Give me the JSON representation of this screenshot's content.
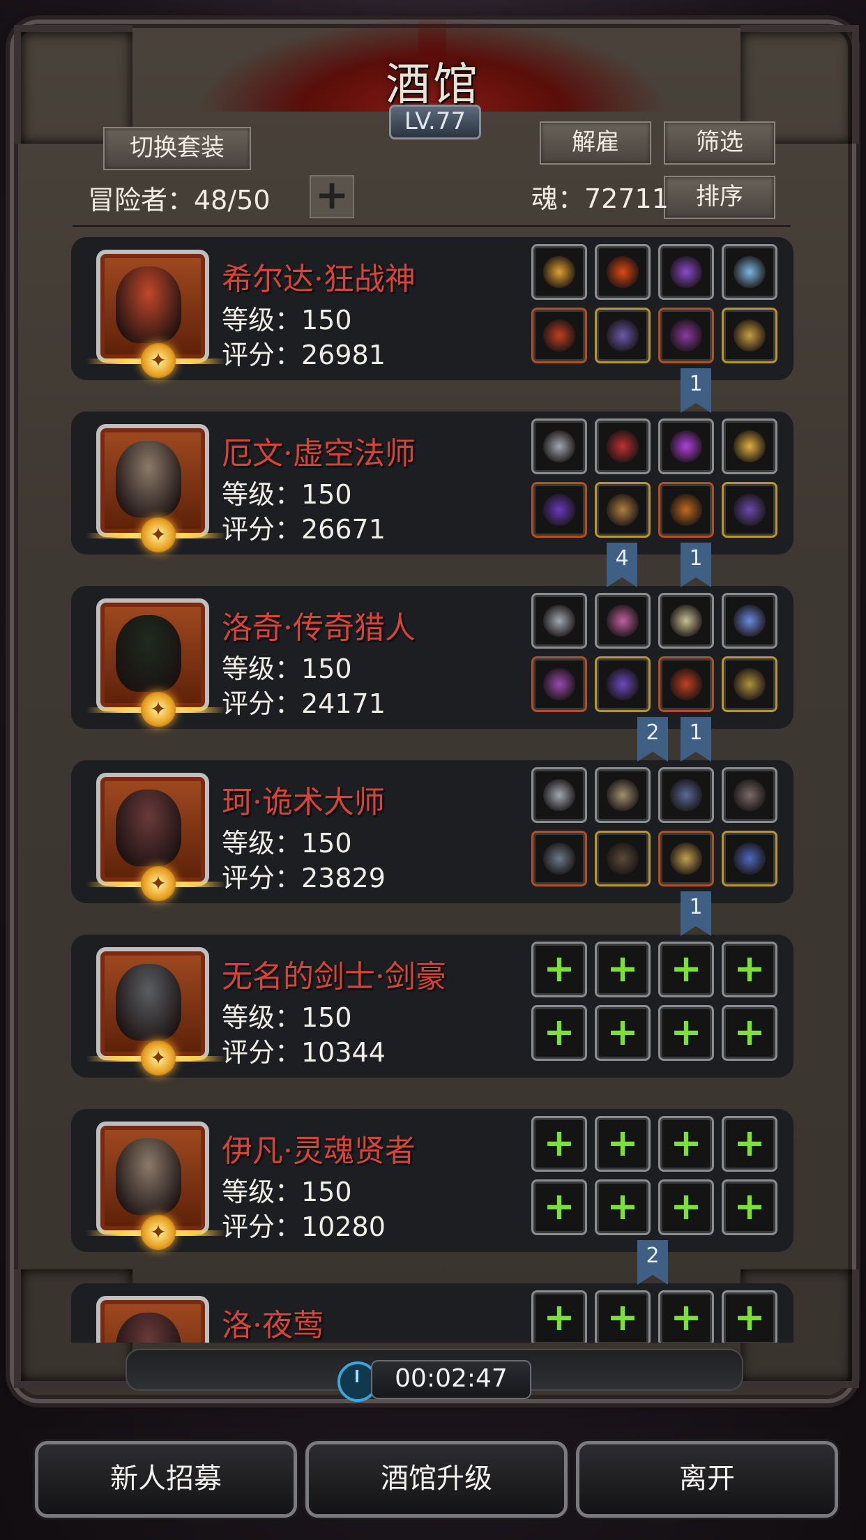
{
  "header": {
    "title": "酒馆",
    "level": "LV.77"
  },
  "toolbar": {
    "switch_outfit": "切换套装",
    "dismiss": "解雇",
    "filter": "筛选",
    "sort": "排序",
    "adventurers_label": "冒险者：48/50",
    "soul_label": "魂：72711",
    "plus": "+"
  },
  "adventurers": [
    {
      "name": "希尔达·狂战神",
      "level": "等级：150",
      "score": "评分：26981",
      "flags": []
    },
    {
      "name": "厄文·虚空法师",
      "level": "等级：150",
      "score": "评分：26671",
      "flags": [
        "1"
      ]
    },
    {
      "name": "洛奇·传奇猎人",
      "level": "等级：150",
      "score": "评分：24171",
      "flags": [
        "4",
        "1"
      ]
    },
    {
      "name": "珂·诡术大师",
      "level": "等级：150",
      "score": "评分：23829",
      "flags": [
        "2",
        "1"
      ]
    },
    {
      "name": "无名的剑士·剑豪",
      "level": "等级：150",
      "score": "评分：10344",
      "flags": [
        "1"
      ]
    },
    {
      "name": "伊凡·灵魂贤者",
      "level": "等级：150",
      "score": "评分：10280",
      "flags": []
    },
    {
      "name": "洛·夜莺",
      "level": "",
      "score": "",
      "flags": [
        "2"
      ]
    }
  ],
  "timer": "00:02:47",
  "bottom": {
    "recruit": "新人招募",
    "upgrade": "酒馆升级",
    "leave": "离开"
  },
  "colors": {
    "name_red": "#d9443a",
    "add_green": "#7de03a",
    "flag_blue": "#3f5f84"
  }
}
